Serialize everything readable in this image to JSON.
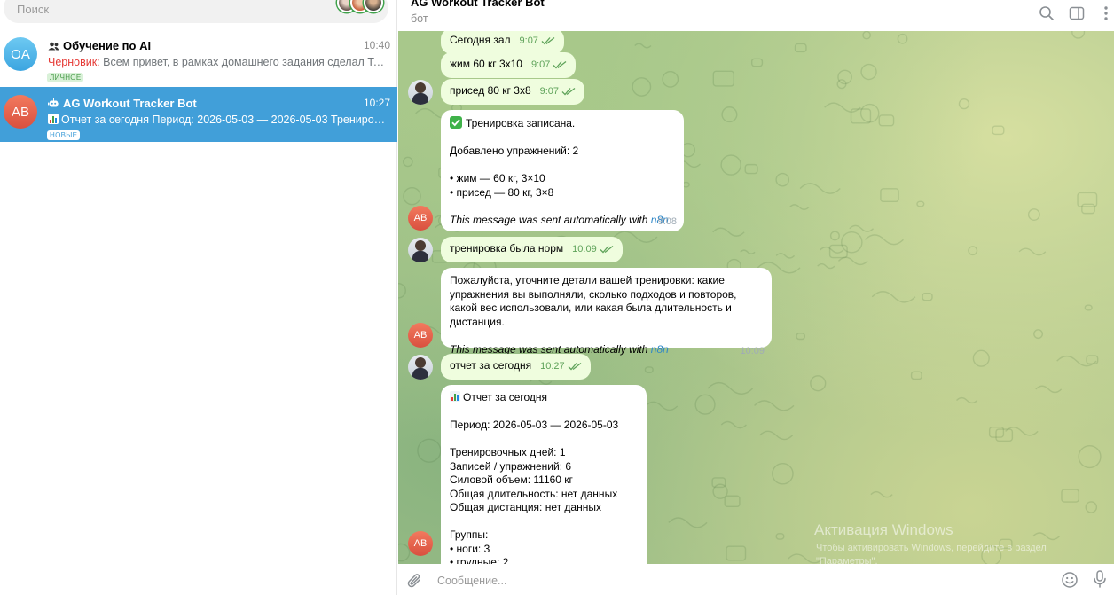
{
  "search": {
    "placeholder": "Поиск"
  },
  "chats": [
    {
      "avatar_initials": "OA",
      "title": "Обучение по AI",
      "time": "10:40",
      "draft_label": "Черновик:",
      "preview": " Всем привет,  в рамках домашнего задания сделал Telegra...",
      "tag": "ЛИЧНОЕ"
    },
    {
      "avatar_initials": "AB",
      "title": "AG Workout Tracker Bot",
      "time": "10:27",
      "preview": "Отчет за сегодня  Период: 2026-05-03 — 2026-05-03  Тренировочн...",
      "tag": "НОВЫЕ"
    }
  ],
  "header": {
    "title": "AG Workout Tracker Bot",
    "subtitle": "бот"
  },
  "messages": {
    "m1": {
      "text": "Сегодня зал",
      "time": "9:07"
    },
    "m2": {
      "text": "жим 60 кг 3х10",
      "time": "9:07"
    },
    "m3": {
      "text": "присед 80 кг 3х8",
      "time": "9:07"
    },
    "m4": {
      "title": "Тренировка записана.",
      "line1": "Добавлено упражнений: 2",
      "line2": "• жим — 60 кг, 3×10",
      "line3": "• присед — 80 кг, 3×8",
      "auto": "This message was sent automatically with ",
      "link": "n8n",
      "time": "9:08"
    },
    "m5": {
      "text": "тренировка была норм",
      "time": "10:09"
    },
    "m6": {
      "text": "Пожалуйста, уточните детали вашей тренировки: какие упражнения вы выполняли, сколько подходов и повторов, какой вес использовали, или какая была длительность и дистанция.",
      "auto": "This message was sent automatically with ",
      "link": "n8n",
      "time": "10:09"
    },
    "m7": {
      "text": "отчет за сегодня",
      "time": "10:27"
    },
    "m8": {
      "title": "Отчет за сегодня",
      "period": "Период: 2026-05-03 — 2026-05-03",
      "l1": "Тренировочных дней: 1",
      "l2": "Записей / упражнений: 6",
      "l3": "Силовой объем: 11160 кг",
      "l4": "Общая длительность: нет данных",
      "l5": "Общая дистанция: нет данных",
      "l6": "Группы:",
      "l7": "• ноги: 3",
      "l8": "• грудные: 2"
    }
  },
  "bot_avatar_initials": "AB",
  "watermark": {
    "title": "Активация Windows",
    "subtitle": "Чтобы активировать Windows, перейдите в раздел \"Параметры\"."
  },
  "composer": {
    "placeholder": "Сообщение..."
  },
  "colors": {
    "accent": "#419fd9",
    "outgoing": "#effdde",
    "incoming": "#ffffff",
    "draft": "#e53935"
  }
}
